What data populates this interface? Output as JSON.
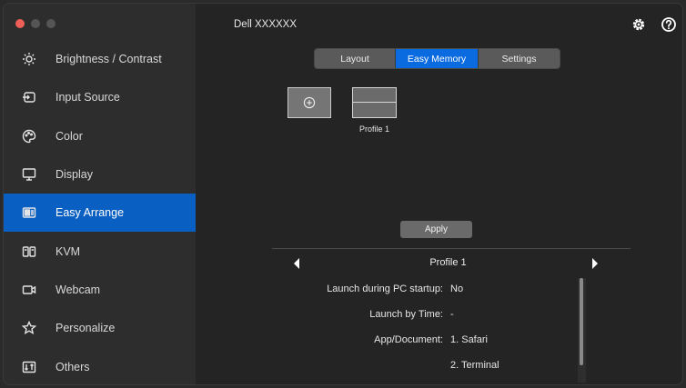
{
  "window": {
    "title": "Dell XXXXXX"
  },
  "sidebar": {
    "items": [
      {
        "label": "Brightness / Contrast",
        "icon": "brightness-icon"
      },
      {
        "label": "Input Source",
        "icon": "input-source-icon"
      },
      {
        "label": "Color",
        "icon": "color-palette-icon"
      },
      {
        "label": "Display",
        "icon": "display-icon"
      },
      {
        "label": "Easy Arrange",
        "icon": "easy-arrange-icon",
        "active": true
      },
      {
        "label": "KVM",
        "icon": "kvm-icon"
      },
      {
        "label": "Webcam",
        "icon": "webcam-icon"
      },
      {
        "label": "Personalize",
        "icon": "star-icon"
      },
      {
        "label": "Others",
        "icon": "others-icon"
      }
    ]
  },
  "tabs": [
    {
      "label": "Layout",
      "active": false
    },
    {
      "label": "Easy Memory",
      "active": true
    },
    {
      "label": "Settings",
      "active": false
    }
  ],
  "profiles": {
    "add_icon": "plus-circle-icon",
    "items": [
      {
        "label": "Profile 1"
      }
    ]
  },
  "apply_label": "Apply",
  "detail": {
    "profile_name": "Profile 1",
    "launch_startup_label": "Launch during PC startup:",
    "launch_startup_value": "No",
    "launch_time_label": "Launch by Time:",
    "launch_time_value": "-",
    "app_doc_label": "App/Document:",
    "apps": [
      "1. Safari",
      "2. Terminal"
    ]
  },
  "colors": {
    "accent": "#0a6ae0",
    "sidebar_active": "#0a5fc2"
  }
}
